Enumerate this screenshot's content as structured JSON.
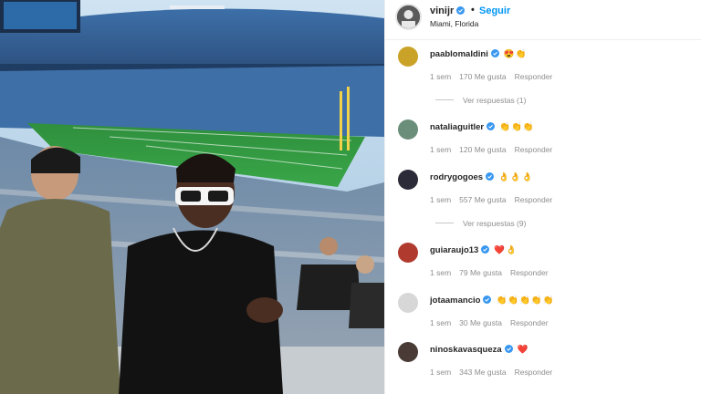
{
  "post": {
    "username": "vinijr",
    "dot": "•",
    "follow_label": "Seguir",
    "location": "Miami, Florida"
  },
  "comments": [
    {
      "username": "paablomaldini",
      "emoji": "😍👏",
      "time": "1 sem",
      "likes": "170 Me gusta",
      "reply": "Responder",
      "replies": "Ver respuestas (1)",
      "avatar_color": "#c9a227"
    },
    {
      "username": "nataliaguitler",
      "emoji": "👏👏👏",
      "time": "1 sem",
      "likes": "120 Me gusta",
      "reply": "Responder",
      "replies": "",
      "avatar_color": "#6b8e7a"
    },
    {
      "username": "rodrygogoes",
      "emoji": "👌👌👌",
      "time": "1 sem",
      "likes": "557 Me gusta",
      "reply": "Responder",
      "replies": "Ver respuestas (9)",
      "avatar_color": "#2b2b3a"
    },
    {
      "username": "guiaraujo13",
      "emoji": "❤️👌",
      "time": "1 sem",
      "likes": "79 Me gusta",
      "reply": "Responder",
      "replies": "",
      "avatar_color": "#b03a2e"
    },
    {
      "username": "jotaamancio",
      "emoji": "👏👏👏👏👏",
      "time": "1 sem",
      "likes": "30 Me gusta",
      "reply": "Responder",
      "replies": "",
      "avatar_color": "#d7d7d7"
    },
    {
      "username": "ninoskavasqueza",
      "emoji": "❤️",
      "time": "1 sem",
      "likes": "343 Me gusta",
      "reply": "Responder",
      "replies": "",
      "avatar_color": "#4a3b36"
    }
  ],
  "colors": {
    "accent": "#0095f6",
    "verified": "#3897f0",
    "muted": "#8e8e8e"
  }
}
